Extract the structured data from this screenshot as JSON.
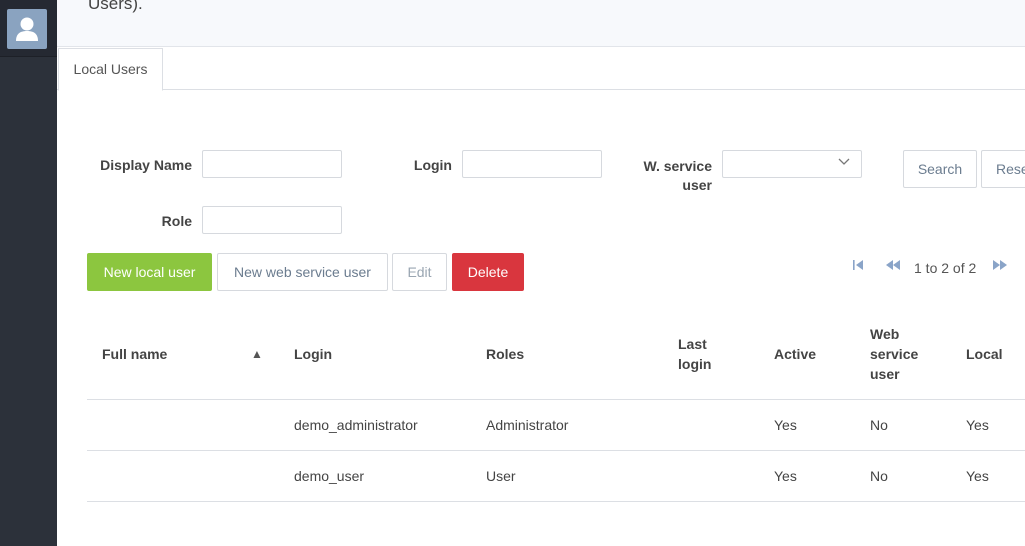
{
  "header": {
    "text": "Users)."
  },
  "tabs": [
    {
      "label": "Local Users"
    }
  ],
  "filters": {
    "display_name_label": "Display Name",
    "display_name_value": "",
    "login_label": "Login",
    "login_value": "",
    "ws_user_label_line1": "W. service",
    "ws_user_label_line2": "user",
    "ws_user_value": "",
    "role_label": "Role",
    "role_value": "",
    "search_label": "Search",
    "reset_label": "Rese"
  },
  "toolbar": {
    "new_local_label": "New local user",
    "new_ws_label": "New web service user",
    "edit_label": "Edit",
    "delete_label": "Delete"
  },
  "pager": {
    "text": "1 to 2 of 2"
  },
  "table": {
    "headers": {
      "full_name": "Full name",
      "sort_indicator": "▲",
      "login": "Login",
      "roles": "Roles",
      "last_login_line1": "Last",
      "last_login_line2": "login",
      "active": "Active",
      "ws_line1": "Web",
      "ws_line2": "service",
      "ws_line3": "user",
      "local": "Local"
    },
    "rows": [
      {
        "full_name": "",
        "login": "demo_administrator",
        "roles": "Administrator",
        "last_login": "",
        "active": "Yes",
        "web_service_user": "No",
        "local": "Yes"
      },
      {
        "full_name": "",
        "login": "demo_user",
        "roles": "User",
        "last_login": "",
        "active": "Yes",
        "web_service_user": "No",
        "local": "Yes"
      }
    ]
  },
  "colors": {
    "accent_green": "#8cc63f",
    "danger_red": "#d9363e",
    "sidebar": "#2c313a",
    "pager_icon": "#8aa4c8"
  },
  "icons": {
    "avatar": "user-avatar-icon",
    "select_chevron": "chevron-down-icon",
    "first": "first-page-icon",
    "prev": "previous-page-icon",
    "next": "next-page-icon"
  }
}
